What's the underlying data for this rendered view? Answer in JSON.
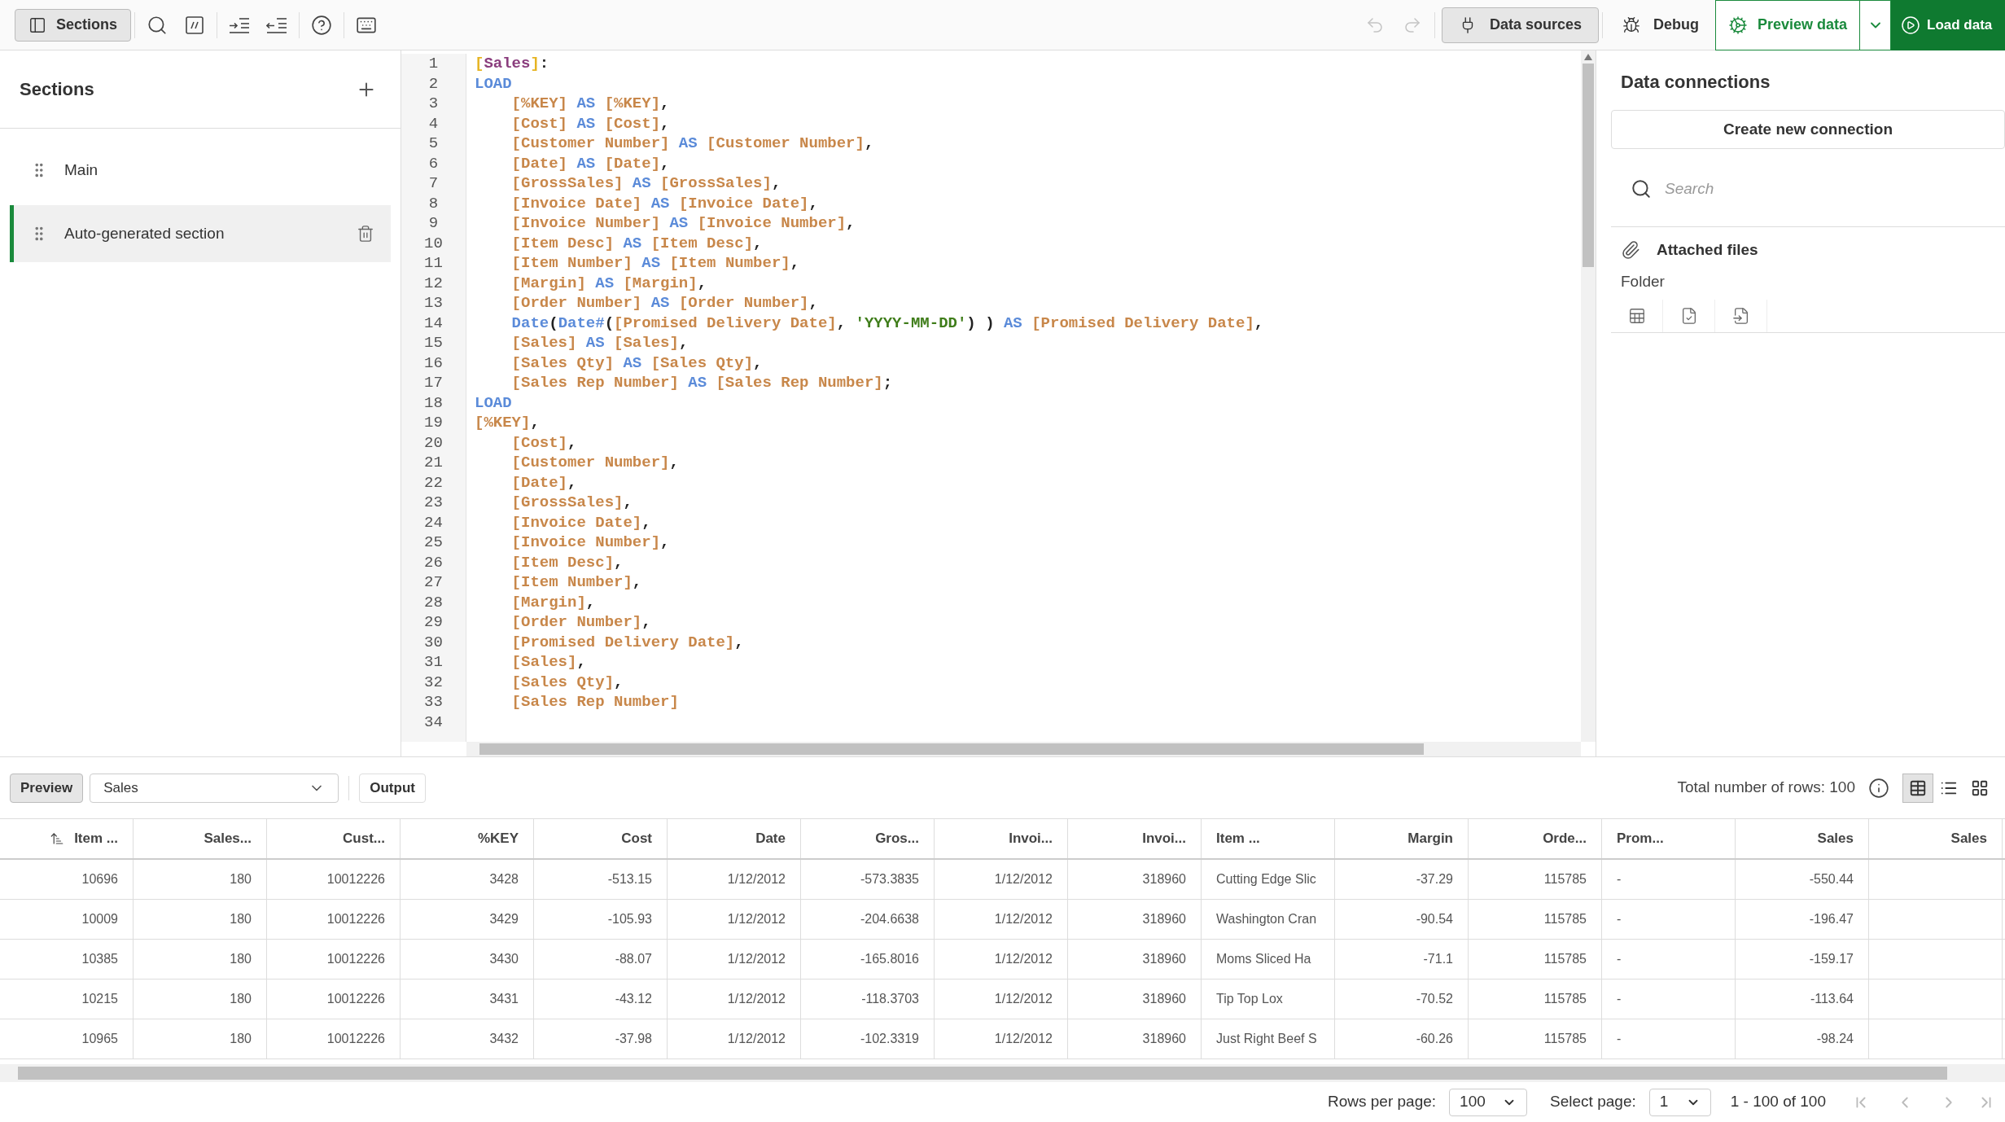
{
  "toolbar": {
    "sections_button": {
      "label": "Sections",
      "selected": true
    },
    "undo": {
      "disabled": true
    },
    "redo": {
      "disabled": true
    },
    "data_sources": {
      "label": "Data sources",
      "selected": true
    },
    "debug": {
      "label": "Debug"
    },
    "preview_data": {
      "label": "Preview data"
    },
    "load_data": {
      "label": "Load data"
    }
  },
  "sections": {
    "title": "Sections",
    "items": [
      {
        "label": "Main",
        "selected": false
      },
      {
        "label": "Auto-generated section",
        "selected": true
      }
    ]
  },
  "editor": {
    "lines": [
      {
        "number": "1",
        "code": "[Sales]:"
      },
      {
        "number": "2",
        "code": "LOAD"
      },
      {
        "number": "3",
        "code": "    [%KEY] AS [%KEY],"
      },
      {
        "number": "4",
        "code": "    [Cost] AS [Cost],"
      },
      {
        "number": "5",
        "code": "    [Customer Number] AS [Customer Number],"
      },
      {
        "number": "6",
        "code": "    [Date] AS [Date],"
      },
      {
        "number": "7",
        "code": "    [GrossSales] AS [GrossSales],"
      },
      {
        "number": "8",
        "code": "    [Invoice Date] AS [Invoice Date],"
      },
      {
        "number": "9",
        "code": "    [Invoice Number] AS [Invoice Number],"
      },
      {
        "number": "10",
        "code": "    [Item Desc] AS [Item Desc],"
      },
      {
        "number": "11",
        "code": "    [Item Number] AS [Item Number],"
      },
      {
        "number": "12",
        "code": "    [Margin] AS [Margin],"
      },
      {
        "number": "13",
        "code": "    [Order Number] AS [Order Number],"
      },
      {
        "number": "14",
        "code": "    Date(Date#([Promised Delivery Date], 'YYYY-MM-DD') ) AS [Promised Delivery Date],"
      },
      {
        "number": "15",
        "code": "    [Sales] AS [Sales],"
      },
      {
        "number": "16",
        "code": "    [Sales Qty] AS [Sales Qty],"
      },
      {
        "number": "17",
        "code": "    [Sales Rep Number] AS [Sales Rep Number];"
      },
      {
        "number": "18",
        "code": "LOAD"
      },
      {
        "number": "19",
        "code": "[%KEY],"
      },
      {
        "number": "20",
        "code": "    [Cost],"
      },
      {
        "number": "21",
        "code": "    [Customer Number],"
      },
      {
        "number": "22",
        "code": "    [Date],"
      },
      {
        "number": "23",
        "code": "    [GrossSales],"
      },
      {
        "number": "24",
        "code": "    [Invoice Date],"
      },
      {
        "number": "25",
        "code": "    [Invoice Number],"
      },
      {
        "number": "26",
        "code": "    [Item Desc],"
      },
      {
        "number": "27",
        "code": "    [Item Number],"
      },
      {
        "number": "28",
        "code": "    [Margin],"
      },
      {
        "number": "29",
        "code": "    [Order Number],"
      },
      {
        "number": "30",
        "code": "    [Promised Delivery Date],"
      },
      {
        "number": "31",
        "code": "    [Sales],"
      },
      {
        "number": "32",
        "code": "    [Sales Qty],"
      },
      {
        "number": "33",
        "code": "    [Sales Rep Number]"
      },
      {
        "number": "34"
      }
    ]
  },
  "data_connections": {
    "title": "Data connections",
    "create_button": "Create new connection",
    "search": {
      "placeholder": "Search"
    },
    "attached_files": "Attached files",
    "folder": "Folder"
  },
  "preview": {
    "preview_button": {
      "label": "Preview",
      "selected": true
    },
    "table_select": "Sales",
    "output_button": {
      "label": "Output",
      "selected": false
    },
    "total_rows": "Total number of rows: 100",
    "view_modes": [
      {
        "kind": "table",
        "selected": true
      },
      {
        "kind": "list",
        "selected": false
      },
      {
        "kind": "grid",
        "selected": false
      }
    ]
  },
  "table": {
    "columns": [
      {
        "label": "Item ...",
        "kind": "number",
        "sorted": true
      },
      {
        "label": "Sales...",
        "kind": "number",
        "sorted": false
      },
      {
        "label": "Cust...",
        "kind": "number",
        "sorted": false
      },
      {
        "label": "%KEY",
        "kind": "number",
        "sorted": false
      },
      {
        "label": "Cost",
        "kind": "number",
        "sorted": false
      },
      {
        "label": "Date",
        "kind": "number",
        "sorted": false
      },
      {
        "label": "Gros...",
        "kind": "number",
        "sorted": false
      },
      {
        "label": "Invoi...",
        "kind": "number",
        "sorted": false
      },
      {
        "label": "Invoi...",
        "kind": "number",
        "sorted": false
      },
      {
        "label": "Item ...",
        "kind": "text",
        "sorted": false
      },
      {
        "label": "Margin",
        "kind": "number",
        "sorted": false
      },
      {
        "label": "Orde...",
        "kind": "number",
        "sorted": false
      },
      {
        "label": "Prom...",
        "kind": "text",
        "sorted": false
      },
      {
        "label": "Sales",
        "kind": "number",
        "sorted": false
      },
      {
        "label": "Sales",
        "kind": "number",
        "sorted": false
      }
    ],
    "rows": [
      [
        "10696",
        "180",
        "10012226",
        "3428",
        "-513.15",
        "1/12/2012",
        "-573.3835",
        "1/12/2012",
        "318960",
        "Cutting Edge Slic",
        "-37.29",
        "115785",
        "-",
        "-550.44"
      ],
      [
        "10009",
        "180",
        "10012226",
        "3429",
        "-105.93",
        "1/12/2012",
        "-204.6638",
        "1/12/2012",
        "318960",
        "Washington Cran",
        "-90.54",
        "115785",
        "-",
        "-196.47"
      ],
      [
        "10385",
        "180",
        "10012226",
        "3430",
        "-88.07",
        "1/12/2012",
        "-165.8016",
        "1/12/2012",
        "318960",
        "Moms Sliced Ha",
        "-71.1",
        "115785",
        "-",
        "-159.17"
      ],
      [
        "10215",
        "180",
        "10012226",
        "3431",
        "-43.12",
        "1/12/2012",
        "-118.3703",
        "1/12/2012",
        "318960",
        "Tip Top Lox",
        "-70.52",
        "115785",
        "-",
        "-113.64"
      ],
      [
        "10965",
        "180",
        "10012226",
        "3432",
        "-37.98",
        "1/12/2012",
        "-102.3319",
        "1/12/2012",
        "318960",
        "Just Right Beef S",
        "-60.26",
        "115785",
        "-",
        "-98.24"
      ]
    ]
  },
  "pagination": {
    "rows_per_page_label": "Rows per page:",
    "rows_per_page": "100",
    "select_page_label": "Select page:",
    "page": "1",
    "range": "1 - 100 of 100"
  }
}
